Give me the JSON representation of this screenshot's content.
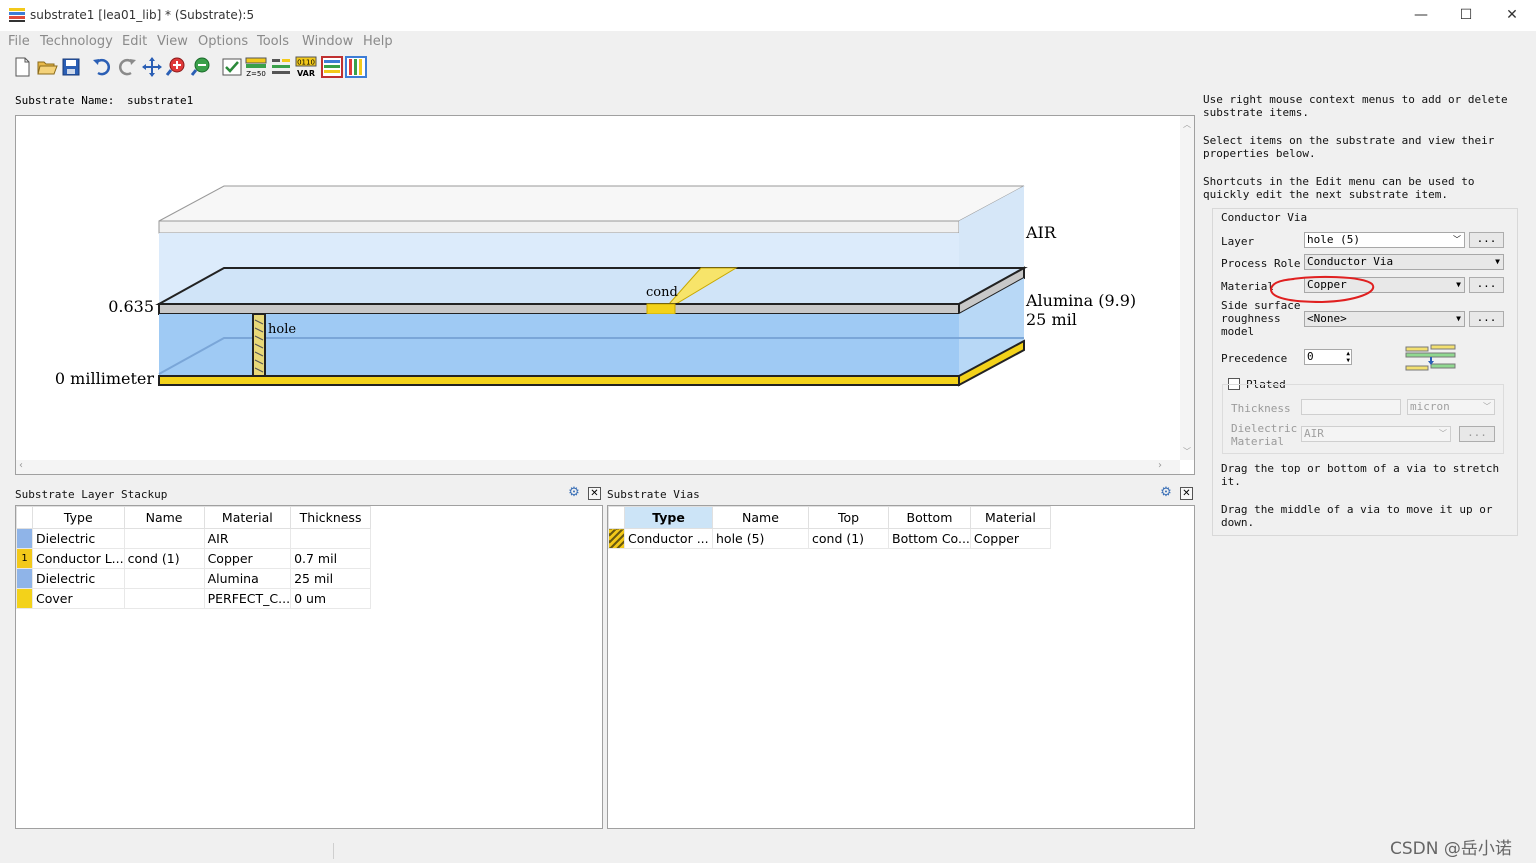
{
  "window": {
    "title": "substrate1 [lea01_lib] * (Substrate):5",
    "minimize": "—",
    "maximize": "☐",
    "close": "✕"
  },
  "menu": [
    "File",
    "Technology",
    "Edit",
    "View",
    "Options",
    "Tools",
    "Window",
    "Help"
  ],
  "toolbar": {
    "icons": [
      "new-file-icon",
      "open-folder-icon",
      "save-icon",
      "undo-icon",
      "redo-icon",
      "move-icon",
      "zoom-in-icon",
      "zoom-out-icon",
      "check-icon",
      "z50-icon",
      "layers-icon",
      "var-icon",
      "stack-horizontal-icon",
      "stack-vertical-icon"
    ],
    "z_label": "Z=50",
    "var_top": "0110",
    "var_label": "VAR"
  },
  "substrate_name": {
    "label": "Substrate Name:",
    "value": "substrate1"
  },
  "view": {
    "air": "AIR",
    "alumina": "Alumina (9.9)",
    "alumina_thick": "25 mil",
    "height_top": "0.635",
    "height_bottom": "0 millimeter",
    "cond": "cond",
    "hole": "hole",
    "colors": {
      "air": "#dcebfb",
      "dielectric": "#9fcaf4",
      "conductor": "#f3d21a",
      "metal": "#c8c8c8"
    }
  },
  "hints": {
    "h1": "Use right mouse context menus to add or delete substrate items.",
    "h2": "Select items on the substrate and view their properties below.",
    "h3": "Shortcuts in the Edit menu can be used to quickly edit the next substrate item.",
    "h4": "Drag the top or bottom of a via to stretch it.",
    "h5": "Drag the middle of a via to move it up or down."
  },
  "via_props": {
    "group": "Conductor Via",
    "layer_label": "Layer",
    "layer_value": "hole (5)",
    "role_label": "Process Role",
    "role_value": "Conductor Via",
    "material_label": "Material",
    "material_value": "Copper",
    "rough_label_1": "Side surface",
    "rough_label_2": "roughness",
    "rough_label_3": "model",
    "rough_value": "<None>",
    "prec_label": "Precedence",
    "prec_value": "0",
    "plated_label": "Plated",
    "thickness_label": "Thickness",
    "thickness_unit": "micron",
    "dielectric_label_1": "Dielectric",
    "dielectric_label_2": "Material",
    "dielectric_value": "AIR",
    "dots": "..."
  },
  "stackup": {
    "title": "Substrate Layer Stackup",
    "headers": [
      "Type",
      "Name",
      "Material",
      "Thickness"
    ],
    "rows": [
      {
        "swatch": "#8fb4e8",
        "num": "",
        "type": "Dielectric",
        "name": "",
        "material": "AIR",
        "thickness": ""
      },
      {
        "swatch": "#f3c91a",
        "num": "1",
        "type": "Conductor L...",
        "name": "cond (1)",
        "material": "Copper",
        "thickness": "0.7 mil"
      },
      {
        "swatch": "#8fb4e8",
        "num": "",
        "type": "Dielectric",
        "name": "",
        "material": "Alumina",
        "thickness": "25 mil"
      },
      {
        "swatch": "#f3d21a",
        "num": "",
        "type": "Cover",
        "name": "",
        "material": "PERFECT_C...",
        "thickness": "0 um"
      }
    ]
  },
  "vias": {
    "title": "Substrate Vias",
    "headers": [
      "Type",
      "Name",
      "Top",
      "Bottom",
      "Material"
    ],
    "rows": [
      {
        "type": "Conductor ...",
        "name": "hole (5)",
        "top": "cond (1)",
        "bottom": "Bottom Co...",
        "material": "Copper"
      }
    ]
  },
  "watermark": "CSDN @岳小诺"
}
